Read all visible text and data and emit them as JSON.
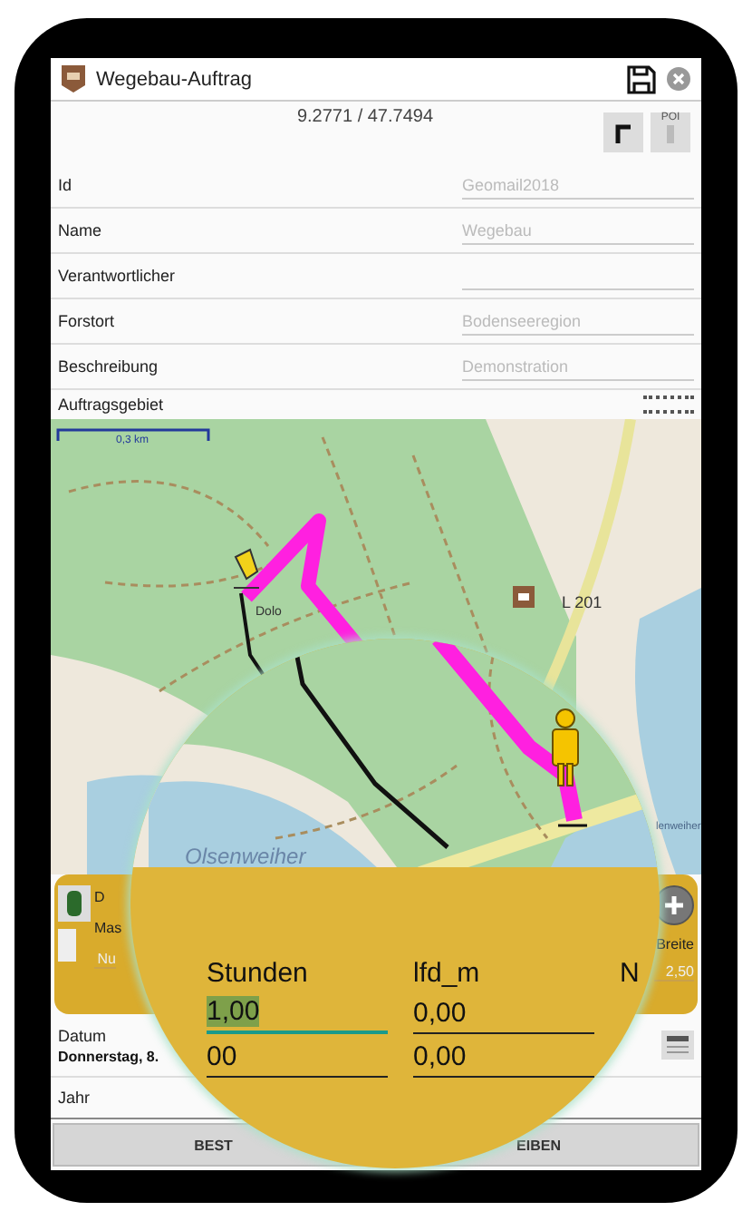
{
  "window": {
    "title": "Wegebau-Auftrag"
  },
  "coordinates": "9.2771 / 47.7494",
  "poi_toggle": {
    "label": "POI",
    "on": false
  },
  "fields": [
    {
      "label": "Id",
      "placeholder": "Geomail2018"
    },
    {
      "label": "Name",
      "placeholder": "Wegebau"
    },
    {
      "label": "Verantwortlicher"
    },
    {
      "label": "Forstort",
      "placeholder": "Bodenseeregion"
    },
    {
      "label": "Beschreibung",
      "placeholder": "Demonstration"
    }
  ],
  "section_label": "Auftragsgebiet",
  "map": {
    "scale": "0,3 km",
    "pin_label": "Dolo",
    "road_label": "L 201",
    "lake_label": "lenweiher"
  },
  "panel": {
    "title": "D",
    "left_label": "Mas",
    "left_placeholder": "Nu",
    "right_label": "Breite",
    "right_placeholder": "2,50"
  },
  "date": {
    "label": "Datum",
    "value": "Donnerstag, 8."
  },
  "year": {
    "label": "Jahr"
  },
  "buttons": [
    "BEST",
    "EIBEN"
  ],
  "magnifier": {
    "lake_label": "Olsenweiher",
    "columns": [
      "Stunden",
      "lfd_m",
      "N"
    ],
    "rows": [
      [
        {
          "value": "1,00",
          "selected": true
        },
        {
          "value": "0,00",
          "selected": false
        }
      ],
      [
        {
          "value": "00",
          "selected": false
        },
        {
          "value": "0,00",
          "selected": false
        }
      ]
    ]
  }
}
